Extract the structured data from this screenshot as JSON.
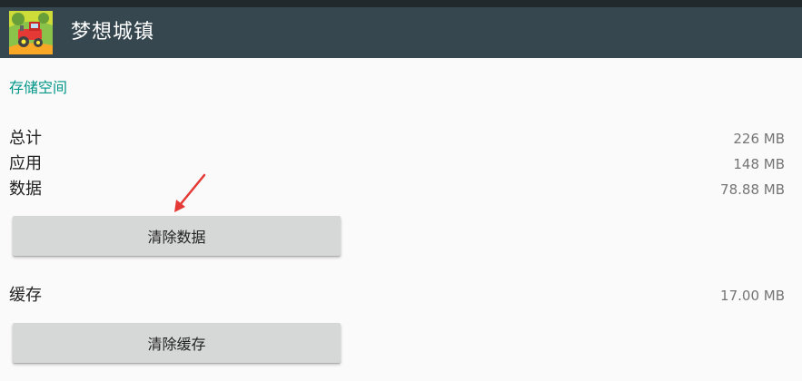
{
  "app": {
    "title": "梦想城镇",
    "icon": "farm-tractor-app-icon"
  },
  "storage": {
    "section_title": "存储空间",
    "total_label": "总计",
    "total_value": "226 MB",
    "app_label": "应用",
    "app_value": "148 MB",
    "data_label": "数据",
    "data_value": "78.88 MB",
    "clear_data_label": "清除数据",
    "cache_label": "缓存",
    "cache_value": "17.00 MB",
    "clear_cache_label": "清除缓存"
  },
  "colors": {
    "appbar": "#37474f",
    "statusbar": "#21292d",
    "accent": "#009688",
    "button": "#d6d7d7",
    "annotation_arrow": "#e53935"
  }
}
